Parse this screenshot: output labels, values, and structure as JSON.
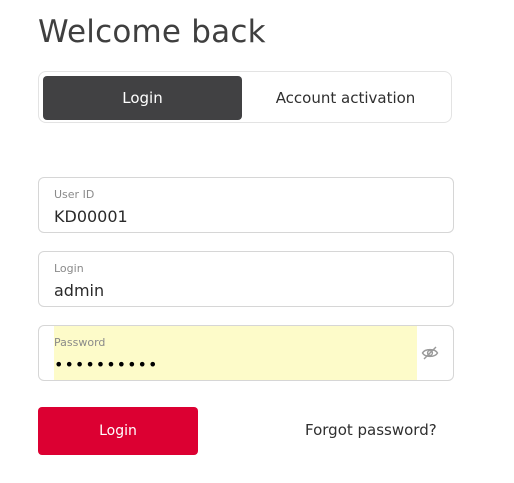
{
  "page": {
    "title": "Welcome back"
  },
  "tabs": [
    {
      "label": "Login",
      "active": true
    },
    {
      "label": "Account activation",
      "active": false
    }
  ],
  "fields": {
    "user_id": {
      "label": "User ID",
      "value": "KD00001"
    },
    "login": {
      "label": "Login",
      "value": "admin"
    },
    "password": {
      "label": "Password",
      "value": "••••••••••",
      "icon": "eye-slash-icon"
    }
  },
  "actions": {
    "login_label": "Login",
    "forgot_label": "Forgot password?"
  },
  "colors": {
    "accent": "#dc0032",
    "active_tab": "#414143",
    "autofill": "#fdfbc9"
  }
}
